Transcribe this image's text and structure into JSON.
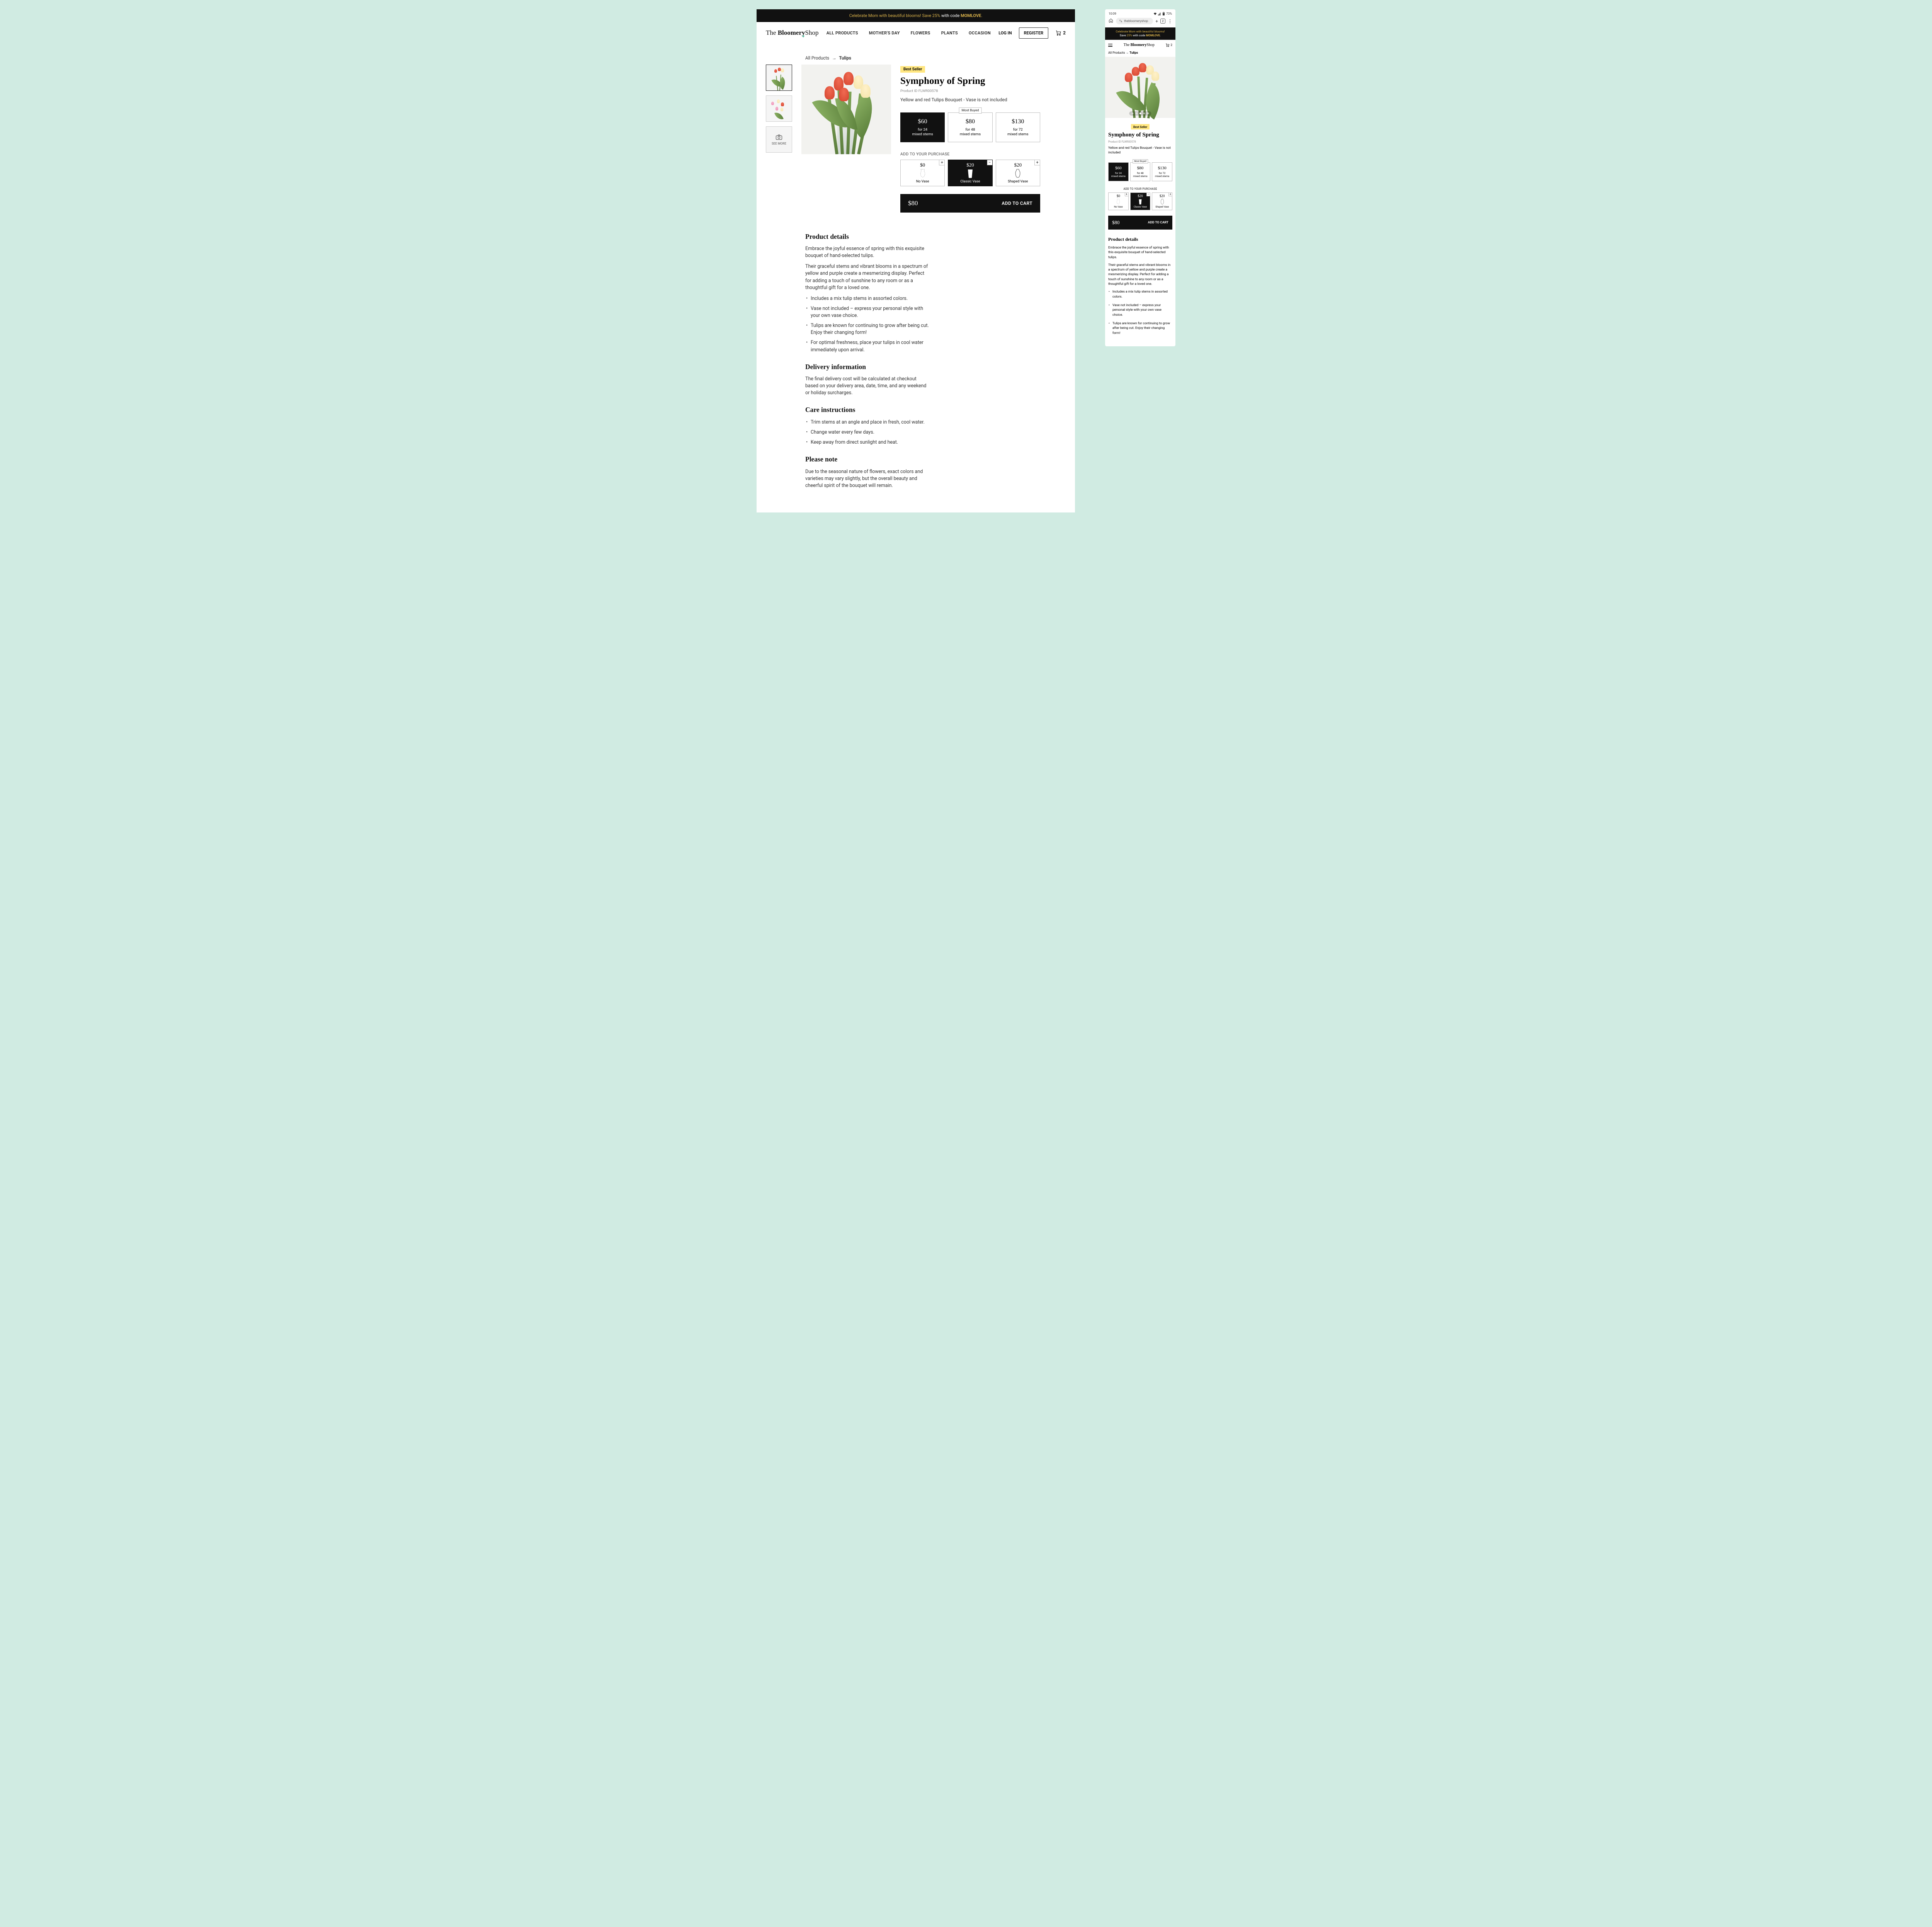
{
  "promo": {
    "pre": "Celebrate Mom with beautiful blooms! Save ",
    "pct": "25%",
    "mid": " with code ",
    "code": "MOMLOVE",
    "end": "."
  },
  "logo": {
    "the": "The ",
    "bloomer": "Bloomer",
    "y": "y",
    "shop": "Shop"
  },
  "nav": {
    "all": "ALL PRODUCTS",
    "mom": "MOTHER'S DAY",
    "flowers": "FLOWERS",
    "plants": "PLANTS",
    "occasion": "OCCASION"
  },
  "account": {
    "login": "LOG IN",
    "register": "REGISTER",
    "cartCount": "2"
  },
  "crumbs": {
    "all": "All Products",
    "arrow": "→",
    "current": "Tulips"
  },
  "thumbs": {
    "seeMore": "SEE MORE"
  },
  "badge": "Best Seller",
  "product": {
    "title": "Symphony of Spring",
    "id": "Product ID FLWR00578",
    "short": "Yellow and red Tulips Bouquet - Vase is not included"
  },
  "mostBuyed": "Most Buyed",
  "stems": [
    {
      "price": "$60",
      "qty1": "for 24",
      "qty2": "mixed stems"
    },
    {
      "price": "$80",
      "qty1": "for 48",
      "qty2": "mixed stems"
    },
    {
      "price": "$130",
      "qty1": "for 72",
      "qty2": "mixed stems"
    }
  ],
  "addonLabel": "ADD TO YOUR PURCHASE",
  "addons": [
    {
      "price": "$0",
      "name": "No Vase",
      "pm": "+"
    },
    {
      "price": "$20",
      "name": "Classic Vase",
      "pm": "−"
    },
    {
      "price": "$20",
      "name": "Shaped Vase",
      "pm": "+"
    }
  ],
  "cart": {
    "total": "$80",
    "label": "ADD TO CART"
  },
  "details": {
    "h1": "Product details",
    "p1": "Embrace the joyful essence of spring with this exquisite bouquet of hand-selected tulips.",
    "p2": "Their graceful stems and vibrant blooms in a spectrum of yellow and purple create a mesmerizing display. Perfect for adding a touch of sunshine to any room or as a thoughtful gift for a loved one.",
    "li1": "Includes a mix tulip stems in assorted colors.",
    "li2": "Vase not included – express your personal style with your own vase choice.",
    "li3": "Tulips are known for continuing to grow after being cut. Enjoy their changing form!",
    "li4": "For optimal freshness, place your tulips in cool water immediately upon arrival.",
    "h2": "Delivery information",
    "p3": "The final delivery cost will be calculated at checkout based on your delivery area, date, time, and any weekend or holiday surcharges.",
    "h3": "Care instructions",
    "ci1": "Trim stems at an angle and place in fresh, cool water.",
    "ci2": "Change water every few days.",
    "ci3": "Keep away from direct sunlight and heat.",
    "h4": "Please note",
    "p4": "Due to the seasonal nature of flowers, exact colors and varieties may vary slightly, but the overall beauty and cheerful spirit of the bouquet will remain."
  },
  "mobile": {
    "time": "10:09",
    "battery": "73%",
    "url": "thebloomeryshop",
    "tabCount": "2",
    "promoLine1": "Celebrate Mom with beautiful blooms!",
    "promoLine2a": "Save ",
    "promoLine2c": " with code "
  }
}
